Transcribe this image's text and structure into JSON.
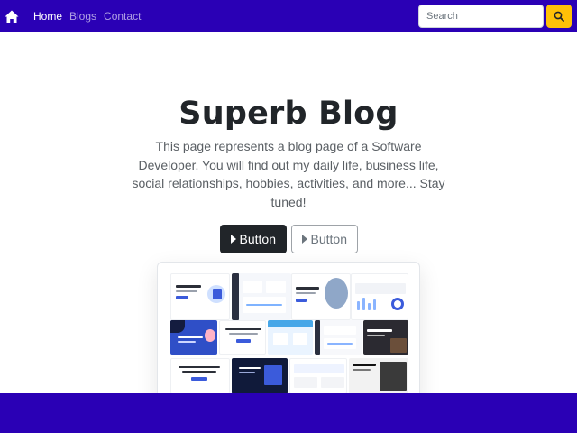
{
  "navbar": {
    "home_icon": "house-icon",
    "links": [
      {
        "label": "Home",
        "active": true
      },
      {
        "label": "Blogs",
        "active": false
      },
      {
        "label": "Contact",
        "active": false
      }
    ],
    "search": {
      "placeholder": "Search",
      "value": "",
      "button_icon": "search-icon"
    },
    "colors": {
      "background": "#2a00b5",
      "search_button": "#ffc107"
    }
  },
  "hero": {
    "title": "Superb Blog",
    "text": "This page represents a blog page of a Software Developer. You will find out my daily life, business life, social relationships, hobbies, activities, and more... Stay tuned!",
    "primary_button": "Button",
    "secondary_button": "Button",
    "button_icon": "caret-right-icon"
  },
  "preview": {
    "image": "website-templates-collage-image"
  },
  "footer": {
    "color": "#2a00b5"
  }
}
